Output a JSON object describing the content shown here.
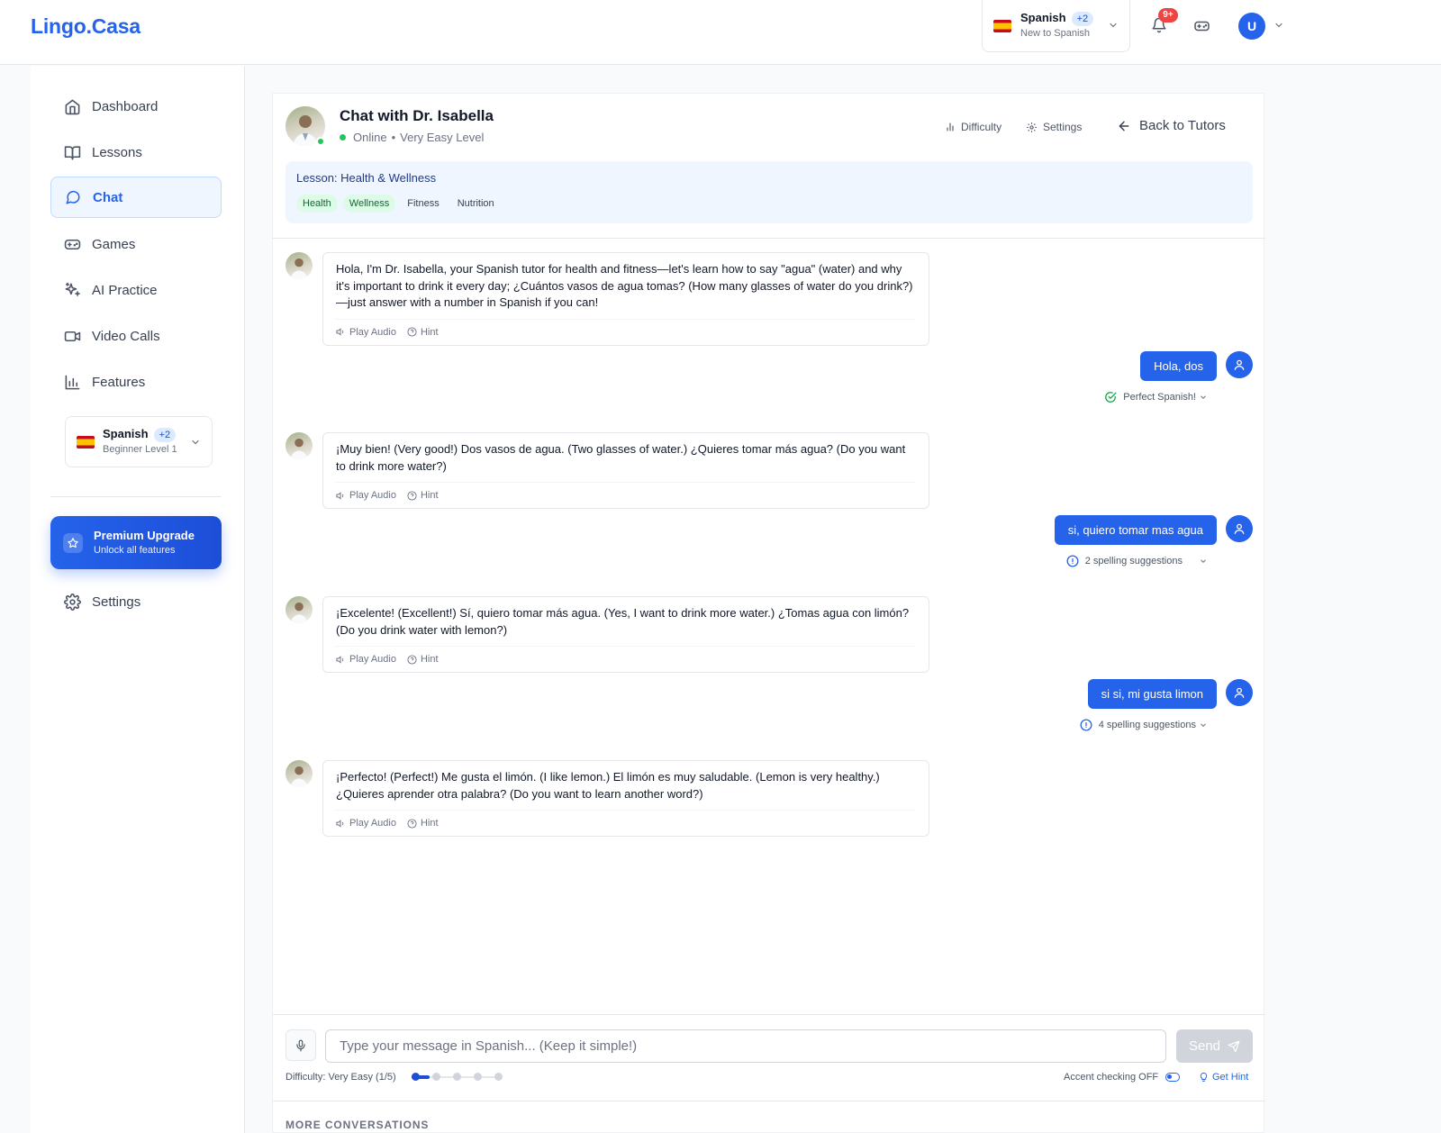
{
  "app": {
    "logo": "Lingo.Casa"
  },
  "header": {
    "language": {
      "name": "Spanish",
      "extra": "+2",
      "level": "New to Spanish"
    },
    "notifications_badge": "9+"
  },
  "user": {
    "initial": "U"
  },
  "sidebar": {
    "items": [
      {
        "label": "Dashboard",
        "icon": "home-icon"
      },
      {
        "label": "Lessons",
        "icon": "book-icon"
      },
      {
        "label": "Chat",
        "icon": "chat-icon",
        "active": true
      },
      {
        "label": "Games",
        "icon": "gamepad-icon"
      },
      {
        "label": "AI Practice",
        "icon": "sparkles-icon"
      },
      {
        "label": "Video Calls",
        "icon": "video-icon"
      },
      {
        "label": "Features",
        "icon": "bar-chart-icon"
      }
    ],
    "language": {
      "name": "Spanish",
      "extra": "+2",
      "level": "Beginner Level 1"
    },
    "premium": {
      "title": "Premium Upgrade",
      "subtitle": "Unlock all features"
    },
    "settings_label": "Settings"
  },
  "chat": {
    "title": "Chat with Dr. Isabella",
    "status": "Online",
    "level": "Very Easy Level",
    "difficulty_btn": "Difficulty",
    "settings_btn": "Settings",
    "back_btn": "Back to Tutors",
    "lesson": {
      "title": "Lesson: Health & Wellness",
      "tags": [
        "Health",
        "Wellness",
        "Fitness",
        "Nutrition"
      ]
    },
    "action_labels": {
      "play_audio": "Play Audio",
      "hint": "Hint"
    },
    "messages": [
      {
        "from": "tutor",
        "text": "Hola, I'm Dr. Isabella, your Spanish tutor for health and fitness—let's learn how to say \"agua\" (water) and why it's important to drink it every day; ¿Cuántos vasos de agua tomas? (How many glasses of water do you drink?)—just answer with a number in Spanish if you can!"
      },
      {
        "from": "user",
        "text": "Hola, dos",
        "feedback": "Perfect Spanish!"
      },
      {
        "from": "tutor",
        "text": "¡Muy bien! (Very good!) Dos vasos de agua. (Two glasses of water.) ¿Quieres tomar más agua? (Do you want to drink more water?)"
      },
      {
        "from": "user",
        "text": "si, quiero tomar mas agua",
        "feedback": "2 spelling suggestions"
      },
      {
        "from": "tutor",
        "text": "¡Excelente! (Excellent!) Sí, quiero tomar más agua. (Yes, I want to drink more water.) ¿Tomas agua con limón? (Do you drink water with lemon?)"
      },
      {
        "from": "user",
        "text": "si si, mi gusta limon",
        "feedback": "4 spelling suggestions"
      },
      {
        "from": "tutor",
        "text": "¡Perfecto! (Perfect!) Me gusta el limón. (I like lemon.) El limón es muy saludable. (Lemon is very healthy.) ¿Quieres aprender otra palabra? (Do you want to learn another word?)"
      }
    ]
  },
  "composer": {
    "placeholder": "Type your message in Spanish... (Keep it simple!)",
    "send_label": "Send",
    "difficulty_label": "Difficulty: Very Easy (1/5)",
    "difficulty_level": 1,
    "difficulty_max": 5,
    "accent_label": "Accent checking OFF",
    "get_hint_label": "Get Hint"
  },
  "more_conversations": "MORE CONVERSATIONS",
  "colors": {
    "accent": "#2563eb",
    "online": "#22c55e",
    "badge": "#ef4444"
  }
}
